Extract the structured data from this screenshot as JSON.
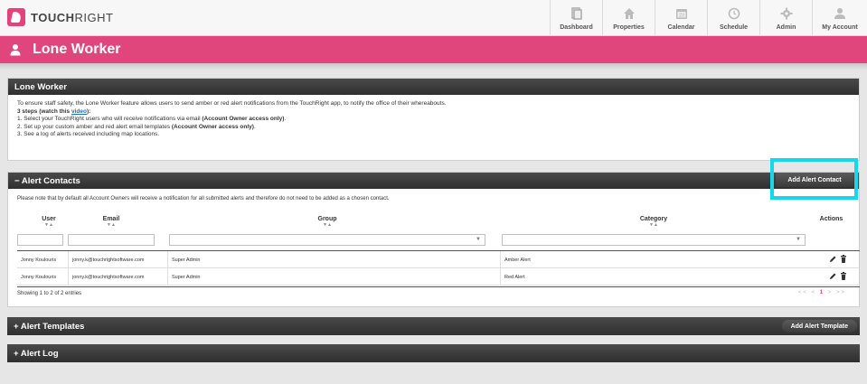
{
  "brand": {
    "name_bold": "TOUCH",
    "name_light": "RIGHT"
  },
  "nav": [
    {
      "label": "Dashboard",
      "icon": "dashboard-icon"
    },
    {
      "label": "Properties",
      "icon": "house-icon"
    },
    {
      "label": "Calendar",
      "icon": "calendar-icon"
    },
    {
      "label": "Schedule",
      "icon": "clock-icon"
    },
    {
      "label": "Admin",
      "icon": "gear-icon"
    },
    {
      "label": "My Account",
      "icon": "user-icon"
    }
  ],
  "page_title": "Lone Worker",
  "intro": {
    "header": "Lone Worker",
    "text": "To ensure staff safety, the Lone Worker feature allows users to send amber or red alert notifications from the TouchRight app, to notify the office of their whereabouts.",
    "steps_prefix": "3 steps (watch this ",
    "steps_link": "video",
    "steps_suffix": "):",
    "step1": "1. Select your TouchRight users who will receive notifications via email ",
    "step1_bold": "(Account Owner access only)",
    "step2": "2. Set up your custom amber and red alert email templates ",
    "step2_bold": "(Account Owner access only)",
    "step3": "3. See a log of alerts received including map locations."
  },
  "alert_contacts": {
    "header": "− Alert Contacts",
    "add_button": "Add Alert Contact",
    "note": "Please note that by default all Account Owners will receive a notification for all submitted alerts and therefore do not need to be added as a chosen contact.",
    "columns": {
      "user": "User",
      "email": "Email",
      "group": "Group",
      "category": "Category",
      "actions": "Actions"
    },
    "rows": [
      {
        "user": "Jonny Koulouris",
        "email": "jonny.k@touchrightsoftware.com",
        "group": "Super Admin",
        "category": "Amber Alert"
      },
      {
        "user": "Jonny Koulouris",
        "email": "jonny.k@touchrightsoftware.com",
        "group": "Super Admin",
        "category": "Red Alert"
      }
    ],
    "showing": "Showing 1 to 2 of 2 entries",
    "pagination": {
      "first": "<<",
      "prev": "<",
      "page": "1",
      "next": ">",
      "last": ">>"
    }
  },
  "alert_templates": {
    "header": "+ Alert Templates",
    "add_button": "Add Alert Template"
  },
  "alert_log": {
    "header": "+ Alert Log"
  },
  "colors": {
    "brand_pink": "#e0457b",
    "highlight_cyan": "#14d9e9",
    "panel_header": "#3a3a3a"
  }
}
